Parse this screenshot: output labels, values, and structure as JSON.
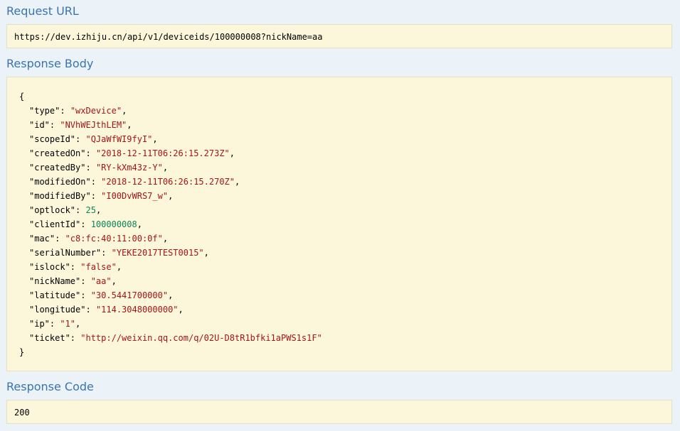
{
  "request_url": {
    "title": "Request URL",
    "value": "https://dev.izhiju.cn/api/v1/deviceids/100000008?nickName=aa"
  },
  "response_body": {
    "title": "Response Body",
    "open_brace": "{",
    "close_brace": "}",
    "entries": [
      {
        "key": "\"type\"",
        "value": "\"wxDevice\"",
        "kind": "string"
      },
      {
        "key": "\"id\"",
        "value": "\"NVhWEJthLEM\"",
        "kind": "string"
      },
      {
        "key": "\"scopeId\"",
        "value": "\"QJaWfWI9fyI\"",
        "kind": "string"
      },
      {
        "key": "\"createdOn\"",
        "value": "\"2018-12-11T06:26:15.273Z\"",
        "kind": "string"
      },
      {
        "key": "\"createdBy\"",
        "value": "\"RY-kXm43z-Y\"",
        "kind": "string"
      },
      {
        "key": "\"modifiedOn\"",
        "value": "\"2018-12-11T06:26:15.270Z\"",
        "kind": "string"
      },
      {
        "key": "\"modifiedBy\"",
        "value": "\"I00DvWRS7_w\"",
        "kind": "string"
      },
      {
        "key": "\"optlock\"",
        "value": "25",
        "kind": "number"
      },
      {
        "key": "\"clientId\"",
        "value": "100000008",
        "kind": "number"
      },
      {
        "key": "\"mac\"",
        "value": "\"c8:fc:40:11:00:0f\"",
        "kind": "string"
      },
      {
        "key": "\"serialNumber\"",
        "value": "\"YEKE2017TEST0015\"",
        "kind": "string"
      },
      {
        "key": "\"islock\"",
        "value": "\"false\"",
        "kind": "string"
      },
      {
        "key": "\"nickName\"",
        "value": "\"aa\"",
        "kind": "string"
      },
      {
        "key": "\"latitude\"",
        "value": "\"30.5441700000\"",
        "kind": "string"
      },
      {
        "key": "\"longitude\"",
        "value": "\"114.3048000000\"",
        "kind": "string"
      },
      {
        "key": "\"ip\"",
        "value": "\"1\"",
        "kind": "string"
      },
      {
        "key": "\"ticket\"",
        "value": "\"http://weixin.qq.com/q/02U-D8tR1bfki1aPWS1s1F\"",
        "kind": "string"
      }
    ]
  },
  "response_code": {
    "title": "Response Code",
    "value": "200"
  },
  "colors": {
    "page_background": "#ebf3f9",
    "section_title": "#3a74b0",
    "box_background": "#fcf6db",
    "string_value": "#a31515",
    "number_value": "#098658"
  }
}
